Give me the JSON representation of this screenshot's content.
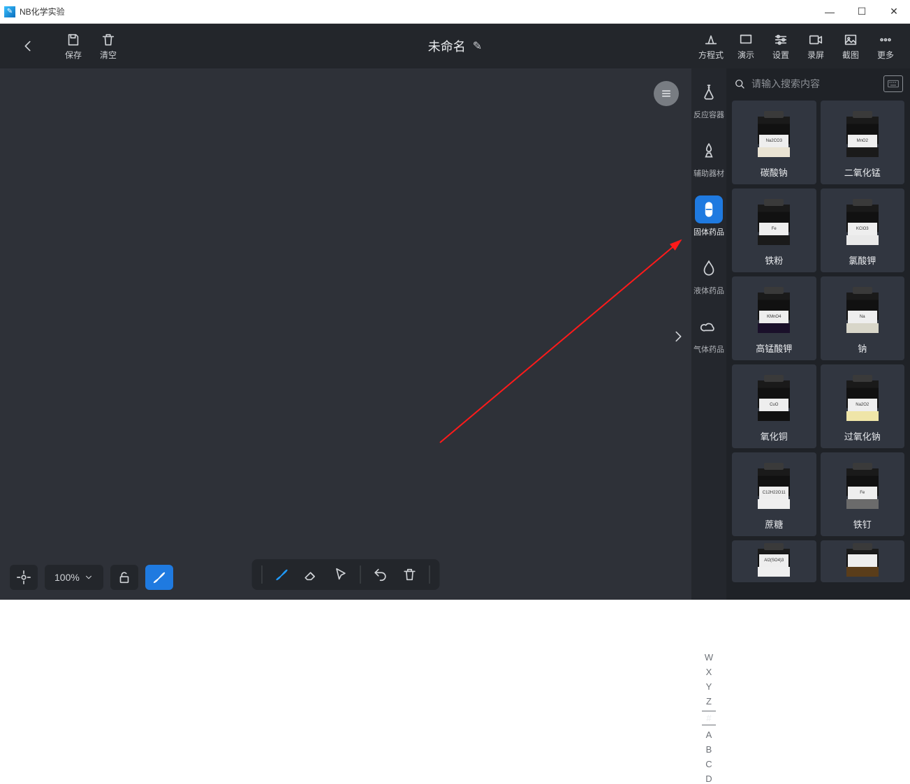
{
  "titlebar": {
    "title": "NB化学实验"
  },
  "topbar": {
    "save": "保存",
    "clear": "清空",
    "doc_title": "未命名",
    "equation": "方程式",
    "present": "演示",
    "settings": "设置",
    "record": "录屏",
    "screenshot": "截图",
    "more": "更多"
  },
  "zoom": {
    "value": "100%"
  },
  "categories": [
    {
      "key": "container",
      "label": "反应容器"
    },
    {
      "key": "aux",
      "label": "辅助器材"
    },
    {
      "key": "solid",
      "label": "固体药品"
    },
    {
      "key": "liquid",
      "label": "液体药品"
    },
    {
      "key": "gas",
      "label": "气体药品"
    }
  ],
  "alpha": [
    "W",
    "X",
    "Y",
    "Z",
    "#",
    "A",
    "B",
    "C",
    "D"
  ],
  "alpha_selected": "#",
  "search": {
    "placeholder": "请输入搜索内容"
  },
  "items": [
    {
      "name": "碳酸钠",
      "formula": "Na2CO3",
      "powder": "#e9e3d3"
    },
    {
      "name": "二氧化锰",
      "formula": "MnO2",
      "powder": "#1a1a1a"
    },
    {
      "name": "铁粉",
      "formula": "Fe",
      "powder": "#1a1a1a"
    },
    {
      "name": "氯酸钾",
      "formula": "KClO3",
      "powder": "#e9e9e9"
    },
    {
      "name": "高锰酸钾",
      "formula": "KMnO4",
      "powder": "#1a102a"
    },
    {
      "name": "钠",
      "formula": "Na",
      "powder": "#d8d6c9"
    },
    {
      "name": "氧化铜",
      "formula": "CuO",
      "powder": "#111"
    },
    {
      "name": "过氧化钠",
      "formula": "Na2O2",
      "powder": "#efe5a8"
    },
    {
      "name": "蔗糖",
      "formula": "C12H22O11",
      "powder": "#efefef"
    },
    {
      "name": "铁钉",
      "formula": "Fe",
      "powder": "#6b6b6b"
    },
    {
      "name": "",
      "formula": "Al2(SO4)3",
      "powder": "#efefef"
    },
    {
      "name": "",
      "formula": "",
      "powder": "#5a3d1a"
    }
  ]
}
